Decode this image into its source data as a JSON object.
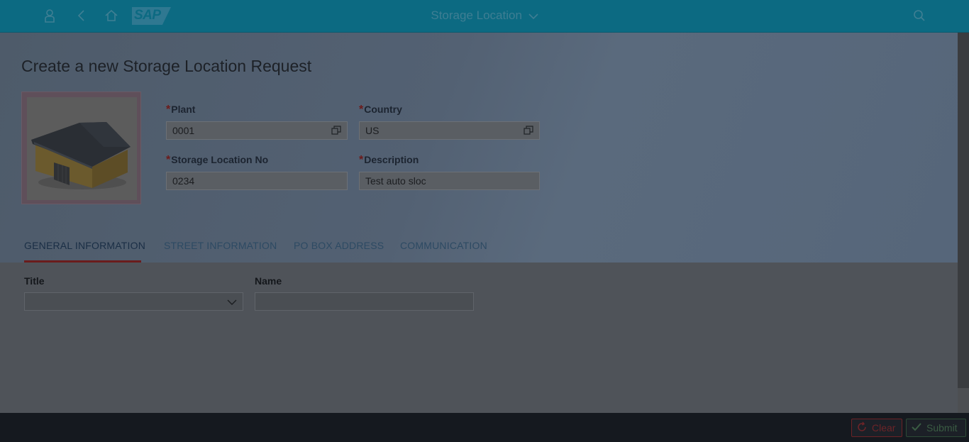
{
  "shell": {
    "title": "Storage Location",
    "logo_text": "SAP",
    "icons": [
      "user-icon",
      "back-icon",
      "home-icon",
      "search-icon"
    ]
  },
  "page": {
    "title": "Create a new Storage Location Request"
  },
  "form": {
    "required_mark": "*",
    "plant": {
      "label": "Plant",
      "value": "0001"
    },
    "country": {
      "label": "Country",
      "value": "US"
    },
    "storage_location_no": {
      "label": "Storage Location No",
      "value": "0234"
    },
    "description": {
      "label": "Description",
      "value": "Test auto sloc"
    }
  },
  "tabs": [
    {
      "label": "GENERAL INFORMATION",
      "active": true
    },
    {
      "label": "STREET INFORMATION",
      "active": false
    },
    {
      "label": "PO BOX ADDRESS",
      "active": false
    },
    {
      "label": "COMMUNICATION",
      "active": false
    }
  ],
  "general": {
    "title_label": "Title",
    "title_value": "",
    "name_label": "Name",
    "name_value": ""
  },
  "footer": {
    "clear_label": "Clear",
    "submit_label": "Submit"
  },
  "colors": {
    "shell": "#0c6a82",
    "required": "#6d1a1a",
    "active_tab_underline": "#6a1c1c",
    "clear": "#6d2428",
    "submit": "#3a5c43"
  }
}
